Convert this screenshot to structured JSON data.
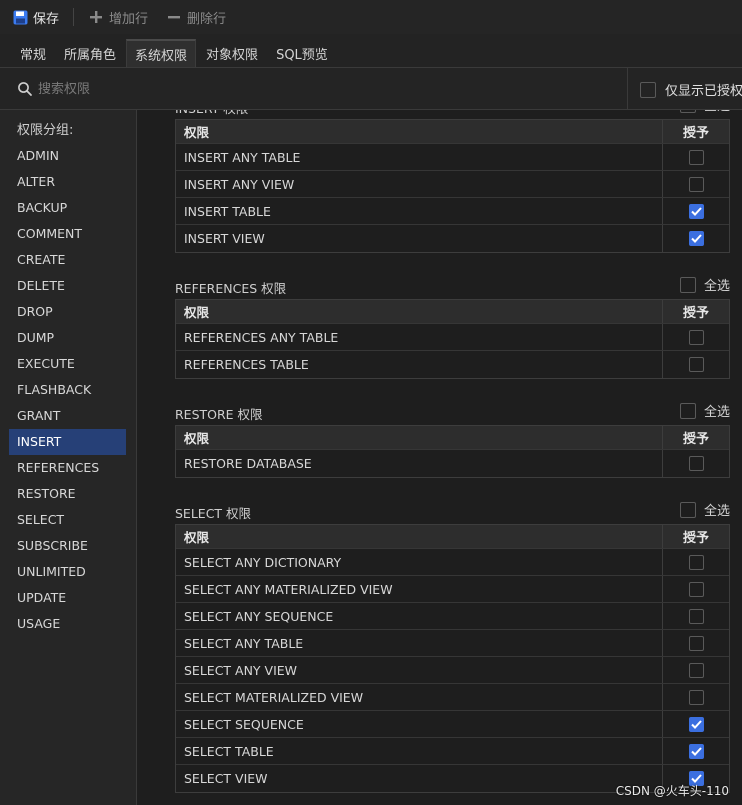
{
  "toolbar": {
    "save_label": "保存",
    "add_row_label": "增加行",
    "delete_row_label": "删除行"
  },
  "tabs": [
    {
      "label": "常规"
    },
    {
      "label": "所属角色"
    },
    {
      "label": "系统权限",
      "active": true
    },
    {
      "label": "对象权限"
    },
    {
      "label": "SQL预览"
    }
  ],
  "search": {
    "placeholder": "搜索权限",
    "only_granted_label": "仅显示已授权"
  },
  "sidebar": {
    "title": "权限分组:",
    "items": [
      {
        "label": "ADMIN"
      },
      {
        "label": "ALTER"
      },
      {
        "label": "BACKUP"
      },
      {
        "label": "COMMENT"
      },
      {
        "label": "CREATE"
      },
      {
        "label": "DELETE"
      },
      {
        "label": "DROP"
      },
      {
        "label": "DUMP"
      },
      {
        "label": "EXECUTE"
      },
      {
        "label": "FLASHBACK"
      },
      {
        "label": "GRANT"
      },
      {
        "label": "INSERT",
        "active": true
      },
      {
        "label": "REFERENCES"
      },
      {
        "label": "RESTORE"
      },
      {
        "label": "SELECT"
      },
      {
        "label": "SUBSCRIBE"
      },
      {
        "label": "UNLIMITED"
      },
      {
        "label": "UPDATE"
      },
      {
        "label": "USAGE"
      }
    ]
  },
  "table_headers": {
    "privilege": "权限",
    "grant": "授予"
  },
  "select_all_label": "全选",
  "sections": [
    {
      "title": "INSERT 权限",
      "rows": [
        {
          "name": "INSERT ANY TABLE",
          "granted": false
        },
        {
          "name": "INSERT ANY VIEW",
          "granted": false
        },
        {
          "name": "INSERT TABLE",
          "granted": true
        },
        {
          "name": "INSERT VIEW",
          "granted": true
        }
      ]
    },
    {
      "title": "REFERENCES 权限",
      "rows": [
        {
          "name": "REFERENCES ANY TABLE",
          "granted": false
        },
        {
          "name": "REFERENCES TABLE",
          "granted": false
        }
      ]
    },
    {
      "title": "RESTORE 权限",
      "rows": [
        {
          "name": "RESTORE DATABASE",
          "granted": false
        }
      ]
    },
    {
      "title": "SELECT 权限",
      "rows": [
        {
          "name": "SELECT ANY DICTIONARY",
          "granted": false
        },
        {
          "name": "SELECT ANY MATERIALIZED VIEW",
          "granted": false
        },
        {
          "name": "SELECT ANY SEQUENCE",
          "granted": false
        },
        {
          "name": "SELECT ANY TABLE",
          "granted": false
        },
        {
          "name": "SELECT ANY VIEW",
          "granted": false
        },
        {
          "name": "SELECT MATERIALIZED VIEW",
          "granted": false
        },
        {
          "name": "SELECT SEQUENCE",
          "granted": true
        },
        {
          "name": "SELECT TABLE",
          "granted": true
        },
        {
          "name": "SELECT VIEW",
          "granted": true
        }
      ]
    }
  ],
  "watermark": "CSDN @火车头-110",
  "colors": {
    "accent": "#3b6fe0",
    "selected_item": "#264077",
    "background": "#1e1e1e"
  }
}
